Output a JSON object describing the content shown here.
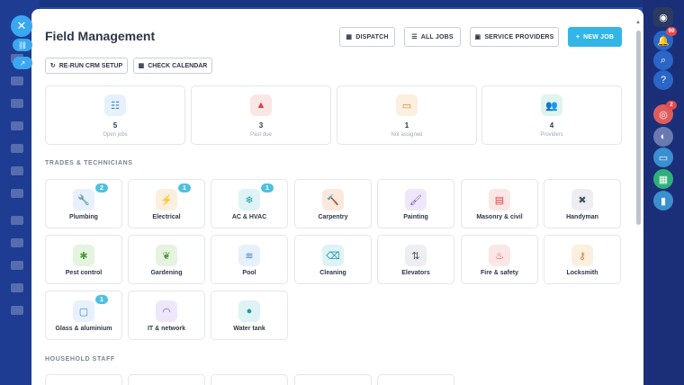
{
  "modal": {
    "title": "Field Management",
    "header_buttons": [
      {
        "label": "DISPATCH",
        "icon": "▦"
      },
      {
        "label": "ALL JOBS",
        "icon": "☰"
      },
      {
        "label": "SERVICE PROVIDERS",
        "icon": "▣"
      }
    ],
    "new_job": {
      "label": "NEW JOB",
      "icon": "+"
    },
    "sub_buttons": [
      {
        "label": "RE-RUN CRM SETUP",
        "icon": "↻"
      },
      {
        "label": "CHECK CALENDAR",
        "icon": "▦"
      }
    ],
    "stats": [
      {
        "value": "5",
        "label": "Open jobs",
        "icon": "☷",
        "icon_color": "#3b82c4",
        "bg": "#e6f1fb"
      },
      {
        "value": "3",
        "label": "Past due",
        "icon": "▲",
        "icon_color": "#d64545",
        "bg": "#fbe6e6"
      },
      {
        "value": "1",
        "label": "Not assigned",
        "icon": "▭",
        "icon_color": "#c7832a",
        "bg": "#fbefdf"
      },
      {
        "value": "4",
        "label": "Providers",
        "icon": "👥",
        "icon_color": "#2c9a78",
        "bg": "#e0f4ee"
      }
    ],
    "sections": {
      "trades": "TRADES & TECHNICIANS",
      "household": "HOUSEHOLD STAFF"
    },
    "trades": [
      {
        "label": "Plumbing",
        "icon": "🔧",
        "color": "#3b82c4",
        "bg": "#e6f1fb",
        "badge": "2"
      },
      {
        "label": "Electrical",
        "icon": "⚡",
        "color": "#c7832a",
        "bg": "#fbefdf",
        "badge": "1"
      },
      {
        "label": "AC & HVAC",
        "icon": "❄",
        "color": "#1f9aa8",
        "bg": "#dff3f5",
        "badge": "1"
      },
      {
        "label": "Carpentry",
        "icon": "🔨",
        "color": "#d96a2a",
        "bg": "#fbe8dc",
        "badge": ""
      },
      {
        "label": "Painting",
        "icon": "🖌",
        "color": "#7b52c7",
        "bg": "#eee7fa",
        "badge": ""
      },
      {
        "label": "Masonry & civil",
        "icon": "▤",
        "color": "#d64545",
        "bg": "#fbe6e6",
        "badge": ""
      },
      {
        "label": "Handyman",
        "icon": "✖",
        "color": "#4a5363",
        "bg": "#eceef2",
        "badge": ""
      },
      {
        "label": "Pest control",
        "icon": "✱",
        "color": "#4c9a3a",
        "bg": "#e5f3df",
        "badge": ""
      },
      {
        "label": "Gardening",
        "icon": "❦",
        "color": "#4c9a3a",
        "bg": "#e5f3df",
        "badge": ""
      },
      {
        "label": "Pool",
        "icon": "≋",
        "color": "#3b82c4",
        "bg": "#e6f1fb",
        "badge": ""
      },
      {
        "label": "Cleaning",
        "icon": "⌫",
        "color": "#1f9aa8",
        "bg": "#dff3f5",
        "badge": ""
      },
      {
        "label": "Elevators",
        "icon": "⇅",
        "color": "#4a5363",
        "bg": "#eceef2",
        "badge": ""
      },
      {
        "label": "Fire & safety",
        "icon": "♨",
        "color": "#d64545",
        "bg": "#fbe6e6",
        "badge": ""
      },
      {
        "label": "Locksmith",
        "icon": "⚷",
        "color": "#c7832a",
        "bg": "#fbefdf",
        "badge": ""
      },
      {
        "label": "Glass & aluminium",
        "icon": "▢",
        "color": "#3b82c4",
        "bg": "#e6f1fb",
        "badge": "1"
      },
      {
        "label": "IT & network",
        "icon": "◠",
        "color": "#7b52c7",
        "bg": "#eee7fa",
        "badge": ""
      },
      {
        "label": "Water tank",
        "icon": "●",
        "color": "#1f9aa8",
        "bg": "#dff3f5",
        "badge": ""
      }
    ],
    "notifications_badge": "99",
    "alert_badge": "2"
  }
}
